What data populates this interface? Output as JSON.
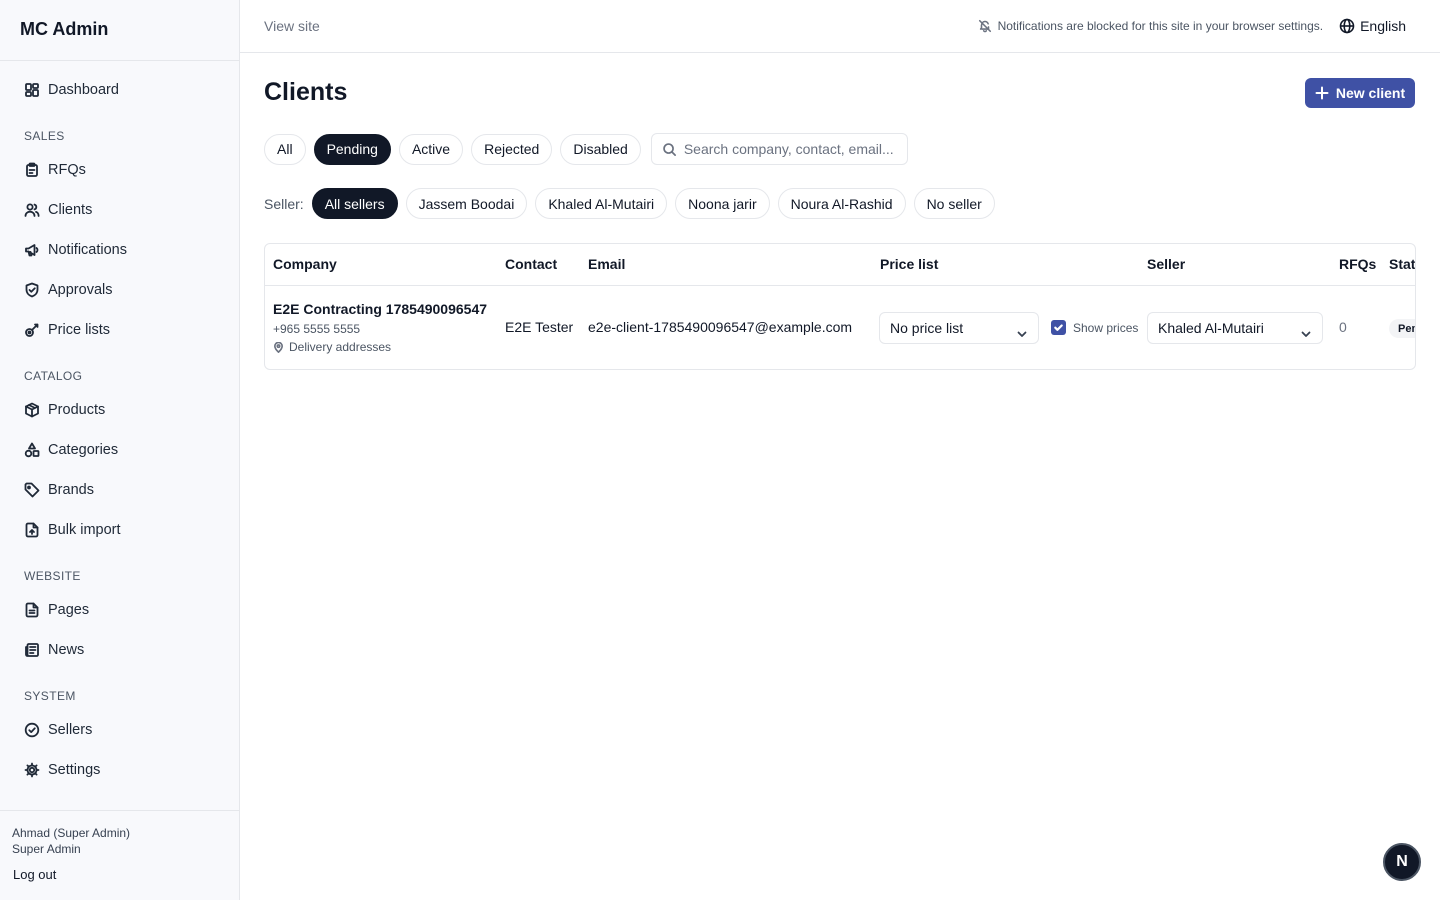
{
  "app": {
    "title": "MC Admin"
  },
  "sidebar": {
    "items": [
      {
        "label": "Dashboard",
        "icon": "dashboard-icon"
      }
    ],
    "sections": [
      {
        "label": "SALES",
        "items": [
          {
            "label": "RFQs",
            "icon": "clipboard-icon"
          },
          {
            "label": "Clients",
            "icon": "users-icon"
          },
          {
            "label": "Notifications",
            "icon": "megaphone-icon"
          },
          {
            "label": "Approvals",
            "icon": "shield-check-icon"
          },
          {
            "label": "Price lists",
            "icon": "price-tag-icon"
          }
        ]
      },
      {
        "label": "CATALOG",
        "items": [
          {
            "label": "Products",
            "icon": "box-icon"
          },
          {
            "label": "Categories",
            "icon": "shapes-icon"
          },
          {
            "label": "Brands",
            "icon": "tag-icon"
          },
          {
            "label": "Bulk import",
            "icon": "file-upload-icon"
          }
        ]
      },
      {
        "label": "WEBSITE",
        "items": [
          {
            "label": "Pages",
            "icon": "file-text-icon"
          },
          {
            "label": "News",
            "icon": "newspaper-icon"
          }
        ]
      },
      {
        "label": "SYSTEM",
        "items": [
          {
            "label": "Sellers",
            "icon": "badge-check-icon"
          },
          {
            "label": "Settings",
            "icon": "gear-icon"
          }
        ]
      }
    ],
    "user": {
      "name": "Ahmad (Super Admin)",
      "role": "Super Admin",
      "logout_label": "Log out"
    }
  },
  "topbar": {
    "view_site_label": "View site",
    "notification_message": "Notifications are blocked for this site in your browser settings.",
    "language": "English"
  },
  "main": {
    "title": "Clients",
    "new_client_label": "New client",
    "status_tabs": [
      {
        "label": "All",
        "active": false
      },
      {
        "label": "Pending",
        "active": true
      },
      {
        "label": "Active",
        "active": false
      },
      {
        "label": "Rejected",
        "active": false
      },
      {
        "label": "Disabled",
        "active": false
      }
    ],
    "search": {
      "placeholder": "Search company, contact, email...",
      "value": ""
    },
    "seller_filter": {
      "label": "Seller:",
      "options": [
        {
          "label": "All sellers",
          "active": true
        },
        {
          "label": "Jassem Boodai",
          "active": false
        },
        {
          "label": "Khaled Al-Mutairi",
          "active": false
        },
        {
          "label": "Noona jarir",
          "active": false
        },
        {
          "label": "Noura Al-Rashid",
          "active": false
        },
        {
          "label": "No seller",
          "active": false
        }
      ]
    },
    "table": {
      "columns": [
        "Company",
        "Contact",
        "Email",
        "Price list",
        "Seller",
        "RFQs",
        "Stat"
      ],
      "rows": [
        {
          "company": "E2E Contracting 1785490096547",
          "phone": "+965 5555 5555",
          "delivery_label": "Delivery addresses",
          "contact": "E2E Tester",
          "email": "e2e-client-1785490096547@example.com",
          "price_list": "No price list",
          "show_prices_label": "Show prices",
          "show_prices_checked": true,
          "seller": "Khaled Al-Mutairi",
          "rfqs": "0",
          "status": "Pending"
        }
      ]
    }
  },
  "fab": {
    "label": "N"
  },
  "colors": {
    "accent": "#3f51a5",
    "active_pill": "#111827",
    "sidebar_bg": "#f8f9fc",
    "border": "#e5e7eb"
  }
}
